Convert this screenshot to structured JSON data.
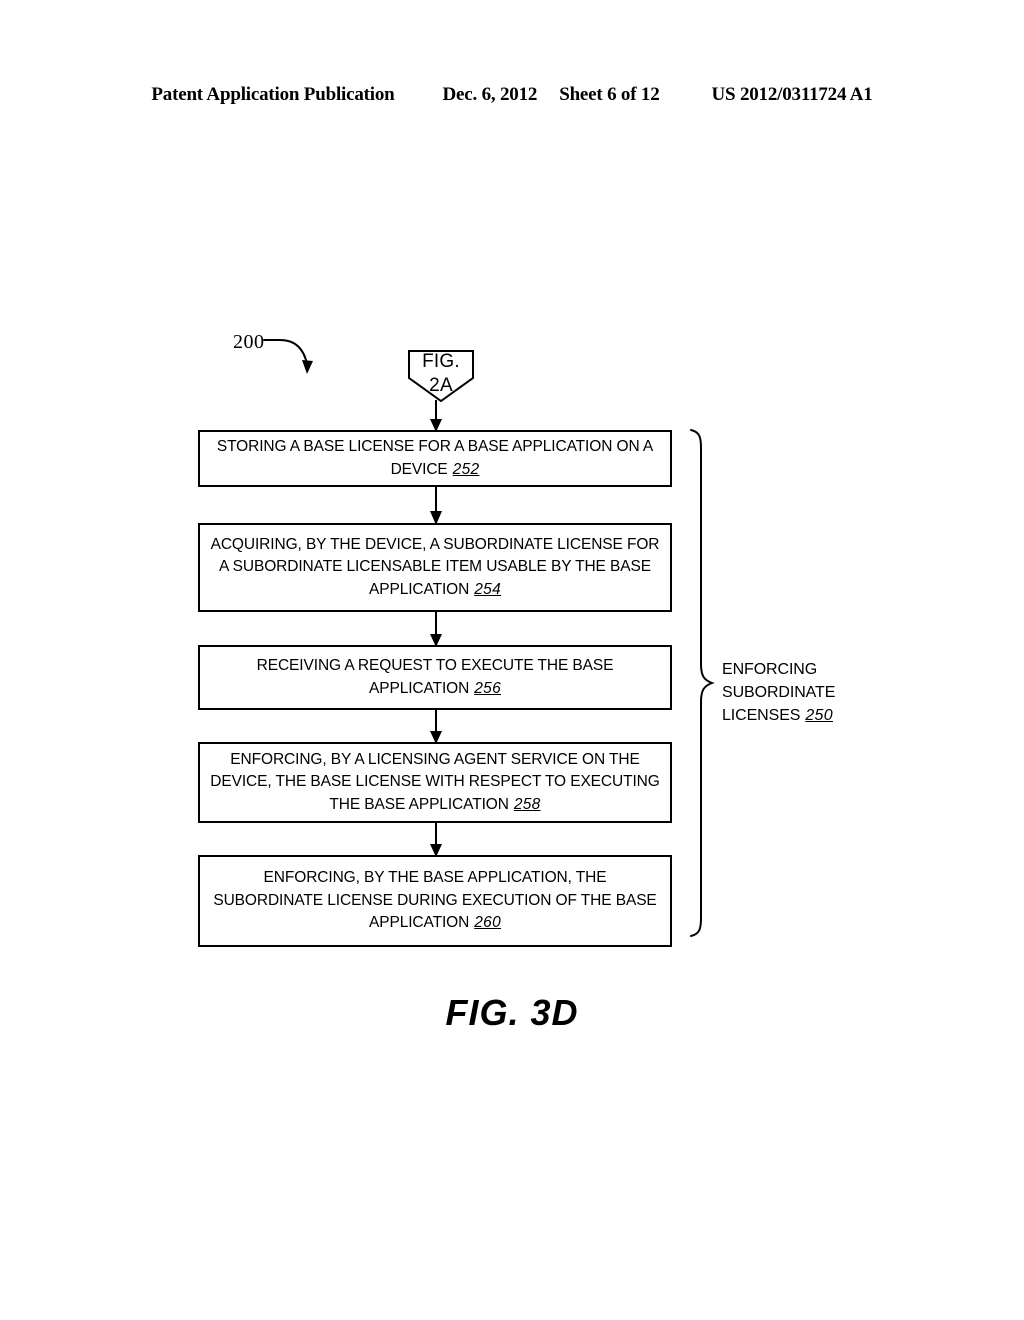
{
  "header": {
    "publication": "Patent Application Publication",
    "date": "Dec. 6, 2012",
    "sheet": "Sheet 6 of 12",
    "patent_number": "US 2012/0311724 A1"
  },
  "figure": {
    "caption": "FIG. 3D",
    "diagram_ref": "200",
    "entry_connector": {
      "line1": "FIG.",
      "line2": "2A"
    },
    "brace_label": {
      "line1": "ENFORCING",
      "line2": "SUBORDINATE",
      "line3": "LICENSES",
      "ref": "250"
    },
    "steps": [
      {
        "id": "252",
        "text": "STORING A BASE LICENSE FOR A BASE APPLICATION ON A DEVICE",
        "ref": "252"
      },
      {
        "id": "254",
        "text": "ACQUIRING, BY THE DEVICE, A SUBORDINATE LICENSE FOR A SUBORDINATE LICENSABLE ITEM USABLE BY THE BASE APPLICATION",
        "ref": "254"
      },
      {
        "id": "256",
        "text": "RECEIVING A REQUEST TO EXECUTE THE BASE APPLICATION",
        "ref": "256"
      },
      {
        "id": "258",
        "text": "ENFORCING, BY A LICENSING AGENT SERVICE ON THE DEVICE, THE BASE LICENSE WITH RESPECT TO EXECUTING THE BASE APPLICATION",
        "ref": "258"
      },
      {
        "id": "260",
        "text": "ENFORCING, BY THE BASE APPLICATION, THE SUBORDINATE LICENSE DURING EXECUTION OF THE BASE APPLICATION",
        "ref": "260"
      }
    ]
  },
  "colors": {
    "ink": "#000000",
    "paper": "#ffffff"
  }
}
